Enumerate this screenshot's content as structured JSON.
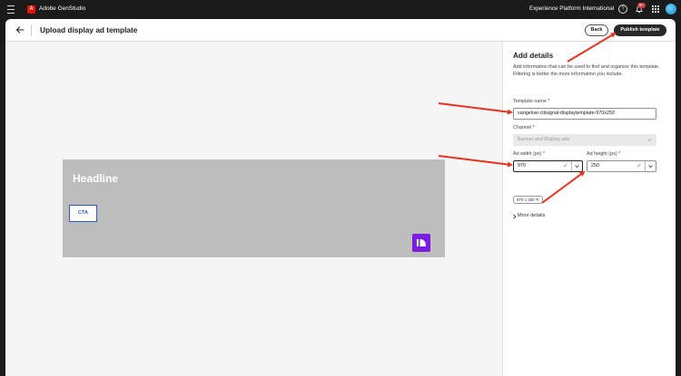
{
  "topbar": {
    "app_name": "Adobe GenStudio",
    "logo_letter": "A",
    "org_name": "Experience Platform International",
    "help_glyph": "?",
    "notification_badge": "9+",
    "icons": [
      "hamburger-icon",
      "adobe-logo-icon",
      "help-icon",
      "bell-icon",
      "apps-grid-icon",
      "avatar"
    ]
  },
  "header": {
    "title": "Upload display ad template",
    "back_label": "Back",
    "publish_label": "Publish template"
  },
  "preview": {
    "headline": "Headline",
    "cta": "CTA"
  },
  "details": {
    "title": "Add details",
    "description": "Add information that can be used to find and organize this template. Filtering is better the more information you include.",
    "template_name_label": "Template name",
    "template_name_value": "vangeluw-citisignal-displaytemplate-970x250",
    "channel_label": "Channel",
    "channel_value": "Banner and Display ads",
    "ad_width_label": "Ad width (px)",
    "ad_width_value": "970",
    "ad_height_label": "Ad height (px)",
    "ad_height_value": "250",
    "size_tag": "970 x 250",
    "more_details": "More details",
    "required_mark": "*"
  },
  "colors": {
    "annotation_arrow": "#e8321e",
    "publish_button": "#292929",
    "brand_purple": "#7b1dde",
    "cta_blue": "#2d5cc0",
    "valid_check": "#2d9d78"
  }
}
